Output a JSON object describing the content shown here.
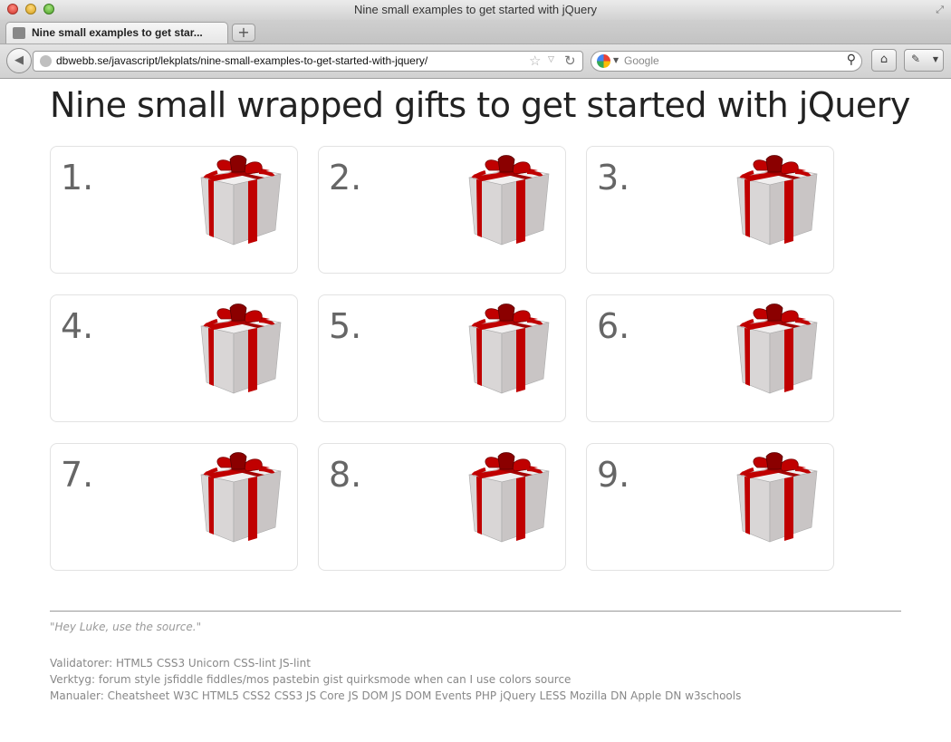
{
  "window": {
    "title": "Nine small examples to get started with jQuery"
  },
  "tabs": [
    {
      "label": "Nine small examples to get star..."
    }
  ],
  "newtab": {
    "label": "+"
  },
  "nav": {
    "url": "dbwebb.se/javascript/lekplats/nine-small-examples-to-get-started-with-jquery/",
    "search_placeholder": "Google"
  },
  "page": {
    "title": "Nine small wrapped gifts to get started with jQuery",
    "gifts": [
      {
        "label": "1."
      },
      {
        "label": "2."
      },
      {
        "label": "3."
      },
      {
        "label": "4."
      },
      {
        "label": "5."
      },
      {
        "label": "6."
      },
      {
        "label": "7."
      },
      {
        "label": "8."
      },
      {
        "label": "9."
      }
    ]
  },
  "footer": {
    "quote": "\"Hey Luke, use the source.\"",
    "validators": {
      "label": "Validatorer:",
      "links": [
        "HTML5",
        "CSS3",
        "Unicorn",
        "CSS-lint",
        "JS-lint"
      ]
    },
    "tools": {
      "label": "Verktyg:",
      "links": [
        "forum style",
        "jsfiddle",
        "fiddles/mos",
        "pastebin",
        "gist",
        "quirksmode",
        "when can I use",
        "colors",
        "source"
      ]
    },
    "manuals": {
      "label": "Manualer:",
      "links": [
        "Cheatsheet",
        "W3C",
        "HTML5",
        "CSS2",
        "CSS3",
        "JS Core",
        "JS DOM",
        "JS DOM Events",
        "PHP",
        "jQuery",
        "LESS",
        "Mozilla DN",
        "Apple DN",
        "w3schools"
      ]
    }
  },
  "colors": {
    "gift_ribbon": "#c00000",
    "gift_box": "#d9d6d6",
    "text_muted": "#888888"
  }
}
